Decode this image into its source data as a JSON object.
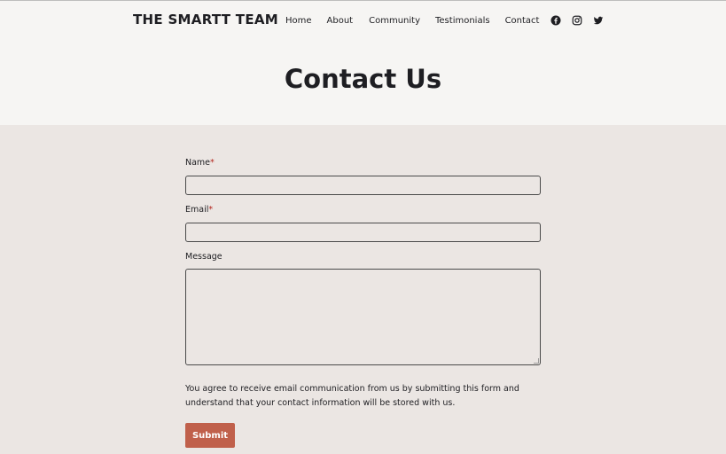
{
  "header": {
    "brand": "THE SMARTT TEAM",
    "nav": [
      "Home",
      "About",
      "Community",
      "Testimonials",
      "Contact"
    ],
    "social_icons": [
      "facebook-icon",
      "instagram-icon",
      "twitter-icon"
    ]
  },
  "hero": {
    "title": "Contact Us"
  },
  "form": {
    "name_label": "Name",
    "email_label": "Email",
    "message_label": "Message",
    "required_marker": "*",
    "name_value": "",
    "email_value": "",
    "message_value": "",
    "consent_text": "You agree to receive email communication from us by submitting this form and understand that your contact information will be stored with us.",
    "submit_label": "Submit"
  },
  "colors": {
    "hero_background": "#f6f5f3",
    "page_background": "#ebe6e3",
    "submit_background": "#c0604b",
    "required_marker": "#b3261e"
  }
}
